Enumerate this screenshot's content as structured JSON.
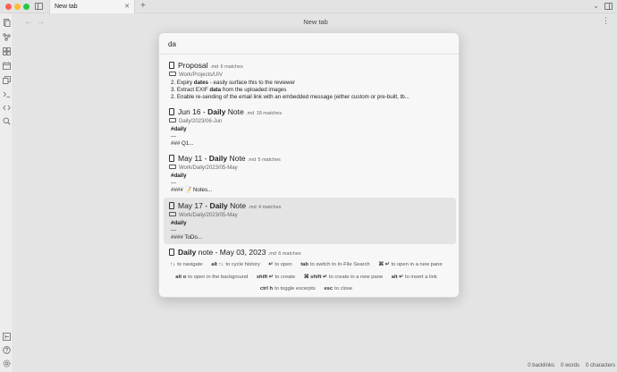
{
  "window": {
    "tab_label": "New tab",
    "tab_close": "✕",
    "new_tab": "+",
    "tab_list": "⌄",
    "page_title": "New tab",
    "nav_back": "←",
    "nav_forward": "→",
    "more_options": "⋮"
  },
  "ribbon": {
    "top_icons": [
      "files-icon",
      "graph-icon",
      "canvas-icon",
      "calendar-icon",
      "copy-icon",
      "terminal-icon",
      "code-icon",
      "search-icon"
    ],
    "bottom_icons": [
      "sidebar-toggle-icon",
      "help-icon",
      "settings-icon"
    ]
  },
  "search": {
    "query": "da",
    "placeholder": ""
  },
  "results": [
    {
      "title_pre": "Proposal",
      "title_hl": "",
      "title_post": "",
      "ext": ".md",
      "matches": "6 matches",
      "path": "Work/Projects/UIV",
      "lines": [
        {
          "pre": "2. Expiry ",
          "hl": "dates",
          "post": " - easily surface this to the reviewer"
        },
        {
          "pre": "3. Extract EXIF ",
          "hl": "data",
          "post": " from the uploaded images"
        },
        {
          "pre": "2. Enable re-sending of the email link with an embedded message (either custom or pre-built, tb...",
          "hl": "",
          "post": ""
        }
      ]
    },
    {
      "title_pre": "Jun 16 - ",
      "title_hl": "Daily",
      "title_post": " Note",
      "ext": ".md",
      "matches": "18 matches",
      "path": "Daily/2023/06-Jun",
      "lines": [
        {
          "pre": "",
          "hl": "#daily",
          "post": ""
        },
        {
          "pre": "---",
          "hl": "",
          "post": ""
        },
        {
          "pre": "### Q1...",
          "hl": "",
          "post": ""
        }
      ]
    },
    {
      "title_pre": "May 11 - ",
      "title_hl": "Daily",
      "title_post": " Note",
      "ext": ".md",
      "matches": "5 matches",
      "path": "Work/Daily/2023/05-May",
      "lines": [
        {
          "pre": "",
          "hl": "#daily",
          "post": ""
        },
        {
          "pre": "---",
          "hl": "",
          "post": ""
        },
        {
          "pre": "#### 📝 Notes...",
          "hl": "",
          "post": ""
        }
      ]
    },
    {
      "title_pre": "May 17 - ",
      "title_hl": "Daily",
      "title_post": " Note",
      "ext": ".md",
      "matches": "4 matches",
      "path": "Work/Daily/2023/05-May",
      "lines": [
        {
          "pre": "",
          "hl": "#daily",
          "post": ""
        },
        {
          "pre": "---",
          "hl": "",
          "post": ""
        },
        {
          "pre": "#### ToDo...",
          "hl": "",
          "post": ""
        }
      ]
    },
    {
      "title_pre": "",
      "title_hl": "Daily",
      "title_post": " note - May 03, 2023",
      "ext": ".md",
      "matches": "6 matches",
      "path": "",
      "lines": []
    }
  ],
  "footer": {
    "row1": [
      {
        "key": "↑↓",
        "label": "to navigate"
      },
      {
        "key": "alt ↑↓",
        "label": "to cycle history"
      },
      {
        "key": "↵",
        "label": "to open"
      },
      {
        "key": "tab",
        "label": "to switch to In-File Search"
      },
      {
        "key": "⌘ ↵",
        "label": "to open in a new pane"
      }
    ],
    "row2": [
      {
        "key": "alt o",
        "label": "to open in the background"
      },
      {
        "key": "shift ↵",
        "label": "to create"
      },
      {
        "key": "⌘ shift ↵",
        "label": "to create in a new pane"
      },
      {
        "key": "alt ↵",
        "label": "to insert a link"
      }
    ],
    "row3": [
      {
        "key": "ctrl h",
        "label": "to toggle excerpts"
      },
      {
        "key": "esc",
        "label": "to close"
      }
    ]
  },
  "status": {
    "backlinks": "0 backlinks",
    "words": "0 words",
    "characters": "0 characters"
  },
  "colors": {
    "traffic_red": "#ff5f57",
    "traffic_yellow": "#febc2e",
    "traffic_green": "#28c840"
  }
}
